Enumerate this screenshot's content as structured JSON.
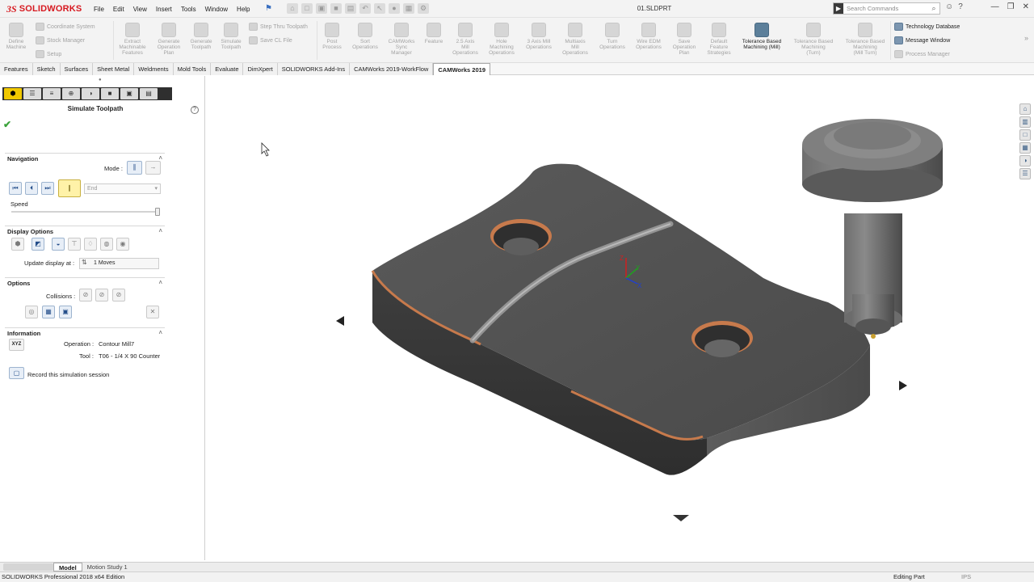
{
  "app": {
    "logo_mark": "3S",
    "logo_text": "SOLIDWORKS",
    "doc_title": "01.SLDPRT"
  },
  "menu": [
    "File",
    "Edit",
    "View",
    "Insert",
    "Tools",
    "Window",
    "Help"
  ],
  "search": {
    "placeholder": "Search Commands"
  },
  "ribbon": {
    "small_group1": [
      "Coordinate System",
      "Stock Manager",
      "Setup"
    ],
    "define_machine": "Define\nMachine",
    "buttons": [
      "Extract\nMachinable\nFeatures",
      "Generate\nOperation\nPlan",
      "Generate\nToolpath",
      "Simulate\nToolpath"
    ],
    "small_group2": [
      "Step Thru Toolpath",
      "Save CL File"
    ],
    "buttons2": [
      "Post\nProcess",
      "Sort\nOperations",
      "CAMWorks\nSync\nManager",
      "Feature",
      "2.5 Axis\nMill\nOperations",
      "Hole\nMachining\nOperations",
      "3 Axis Mill\nOperations",
      "Multiaxis\nMill\nOperations",
      "Turn\nOperations",
      "Wire EDM\nOperations",
      "Save\nOperation\nPlan",
      "Default\nFeature\nStrategies",
      "Tolerance Based\nMachining (Mill)",
      "Tolerance Based\nMachining\n(Turn)",
      "Tolerance Based\nMachining\n(Mill Turn)"
    ],
    "right_items": [
      "Technology Database",
      "Message Window",
      "Process Manager"
    ]
  },
  "tabs": [
    "Features",
    "Sketch",
    "Surfaces",
    "Sheet Metal",
    "Weldments",
    "Mold Tools",
    "Evaluate",
    "DimXpert",
    "SOLIDWORKS Add-Ins",
    "CAMWorks 2019-WorkFlow",
    "CAMWorks 2019"
  ],
  "panel": {
    "title": "Simulate Toolpath",
    "navigation": {
      "header": "Navigation",
      "mode_label": "Mode :",
      "step_value": "End",
      "speed_label": "Speed"
    },
    "display": {
      "header": "Display Options",
      "update_label": "Update display at :",
      "update_value": "1 Moves"
    },
    "options": {
      "header": "Options",
      "collisions_label": "Collisions :"
    },
    "information": {
      "header": "Information",
      "xyz": "XYZ",
      "operation_label": "Operation :",
      "operation_value": "Contour Mill7",
      "tool_label": "Tool :",
      "tool_value": "T06 - 1/4 X 90 Counter",
      "record_label": "Record this simulation session"
    }
  },
  "bottom_tabs": [
    "Model",
    "Motion Study 1"
  ],
  "status": {
    "left": "SOLIDWORKS Professional 2018 x64 Edition",
    "mode": "Editing Part",
    "units": "IPS"
  },
  "colors": {
    "accent": "#d71920",
    "part": "#4e4e4e",
    "copper": "#c77a4c"
  }
}
